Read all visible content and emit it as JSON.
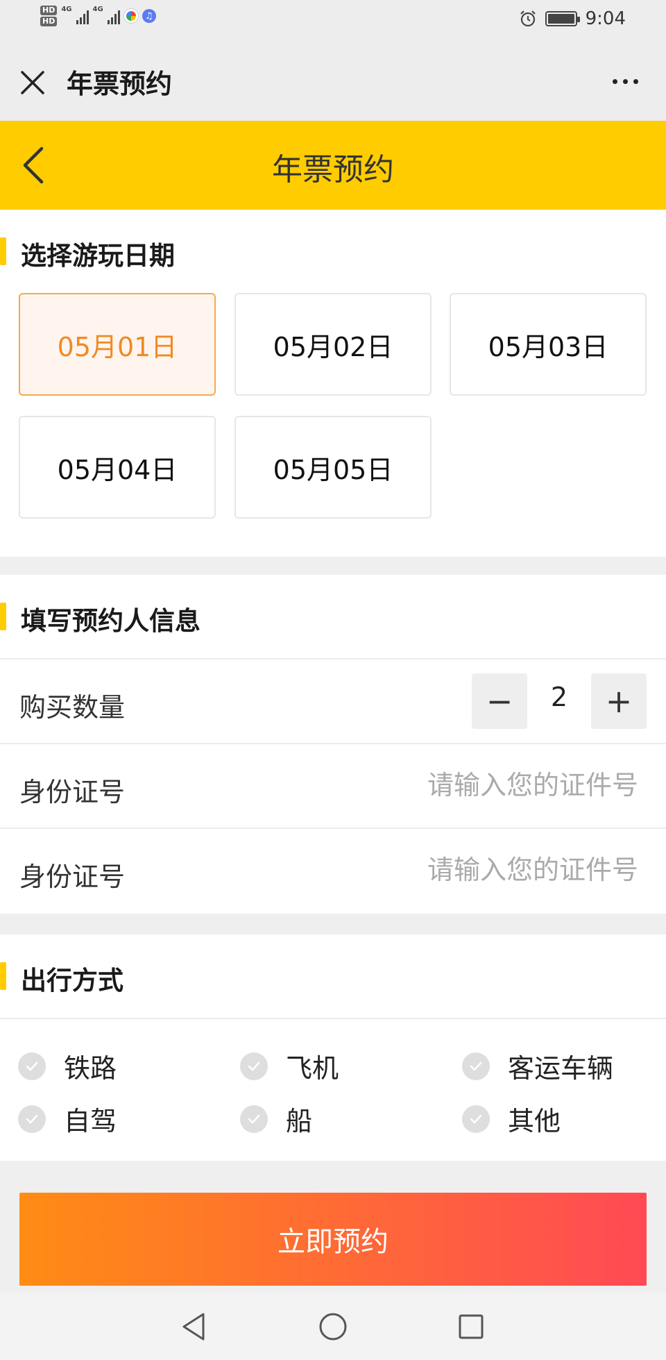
{
  "status_bar": {
    "hd1": "HD",
    "hd2": "HD",
    "net1": "4G",
    "net2": "4G",
    "time": "9:04",
    "icons": [
      "hd-icon",
      "signal-icon",
      "app-icon",
      "music-app-icon",
      "alarm-icon",
      "battery-icon"
    ]
  },
  "webview": {
    "title": "年票预约",
    "close_icon": "close-icon",
    "more_icon": "more-icon"
  },
  "header": {
    "title": "年票预约",
    "back_icon": "chevron-left-icon",
    "color": "#ffcc00"
  },
  "date_section": {
    "title": "选择游玩日期",
    "dates": [
      "05月01日",
      "05月02日",
      "05月03日",
      "05月04日",
      "05月05日"
    ],
    "selected_index": 0,
    "selected_color": "#f08a24"
  },
  "booker_section": {
    "title": "填写预约人信息",
    "quantity_label": "购买数量",
    "quantity_value": "2",
    "minus_label": "−",
    "plus_label": "+",
    "id_rows": [
      {
        "label": "身份证号",
        "placeholder": "请输入您的证件号"
      },
      {
        "label": "身份证号",
        "placeholder": "请输入您的证件号"
      }
    ]
  },
  "transport_section": {
    "title": "出行方式",
    "options": [
      "铁路",
      "飞机",
      "客运车辆",
      "自驾",
      "船",
      "其他"
    ]
  },
  "submit": {
    "label": "立即预约",
    "gradient_start": "#ff8c14",
    "gradient_end": "#ff4a55"
  },
  "nav_bar": {
    "icons": [
      "back-triangle-icon",
      "home-circle-icon",
      "recents-square-icon"
    ]
  }
}
